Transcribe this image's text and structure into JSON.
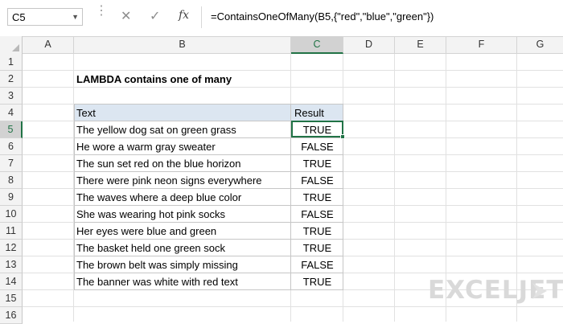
{
  "formula_bar": {
    "name_box": "C5",
    "cancel_icon": "✕",
    "enter_icon": "✓",
    "fx_label": "fx",
    "formula": "=ContainsOneOfMany(B5,{\"red\",\"blue\",\"green\"})"
  },
  "columns": [
    "A",
    "B",
    "C",
    "D",
    "E",
    "F",
    "G"
  ],
  "rows": [
    "1",
    "2",
    "3",
    "4",
    "5",
    "6",
    "7",
    "8",
    "9",
    "10",
    "11",
    "12",
    "13",
    "14",
    "15",
    "16"
  ],
  "sheet": {
    "title": "LAMBDA contains one of many",
    "table": {
      "headers": [
        "Text",
        "Result"
      ],
      "rows": [
        [
          "The yellow dog sat on green grass",
          "TRUE"
        ],
        [
          "He wore a warm gray sweater",
          "FALSE"
        ],
        [
          "The sun set red on the blue horizon",
          "TRUE"
        ],
        [
          "There were pink neon signs everywhere",
          "FALSE"
        ],
        [
          "The waves where a deep blue color",
          "TRUE"
        ],
        [
          "She was wearing hot pink socks",
          "FALSE"
        ],
        [
          "Her eyes were blue and green",
          "TRUE"
        ],
        [
          "The basket held one green sock",
          "TRUE"
        ],
        [
          "The brown belt was simply missing",
          "FALSE"
        ],
        [
          "The banner was white with red text",
          "TRUE"
        ]
      ]
    }
  },
  "watermark": "EXCELJET",
  "colors": {
    "accent": "#217346",
    "header_fill": "#dce6f1",
    "logo": "#d9d9d9"
  },
  "icons": {
    "name_box_dropdown": "chevron-down-icon",
    "logo_mark": "exceljet-logo-icon"
  }
}
